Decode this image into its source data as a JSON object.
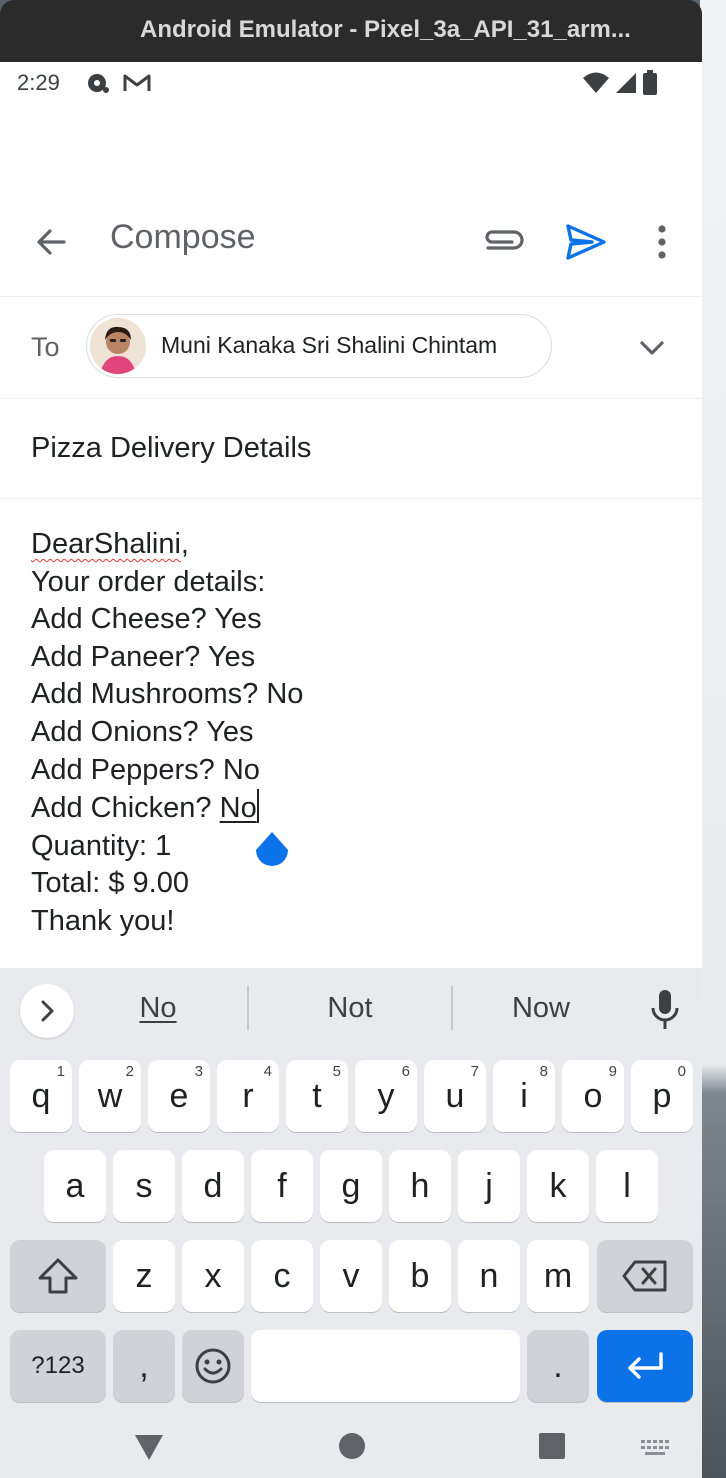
{
  "window": {
    "title": "Android Emulator - Pixel_3a_API_31_arm..."
  },
  "status_bar": {
    "time": "2:29"
  },
  "app_bar": {
    "title": "Compose"
  },
  "to": {
    "label": "To",
    "recipient": "Muni Kanaka Sri Shalini Chintam"
  },
  "subject": "Pizza Delivery Details",
  "body": {
    "greeting_name": "DearShalini",
    "greeting_punct": ",",
    "lines": [
      "Your order details:",
      "Add Cheese? Yes",
      "Add Paneer? Yes",
      "Add Mushrooms? No",
      "Add Onions? Yes",
      "Add Peppers? No"
    ],
    "chicken_prefix": "Add Chicken? ",
    "chicken_value": "No",
    "tail_lines": [
      "Quantity: 1",
      "Total: $ 9.00",
      "Thank you!"
    ]
  },
  "suggestions": [
    "No",
    "Not",
    "Now"
  ],
  "keyboard": {
    "row1": [
      {
        "k": "q",
        "n": "1"
      },
      {
        "k": "w",
        "n": "2"
      },
      {
        "k": "e",
        "n": "3"
      },
      {
        "k": "r",
        "n": "4"
      },
      {
        "k": "t",
        "n": "5"
      },
      {
        "k": "y",
        "n": "6"
      },
      {
        "k": "u",
        "n": "7"
      },
      {
        "k": "i",
        "n": "8"
      },
      {
        "k": "o",
        "n": "9"
      },
      {
        "k": "p",
        "n": "0"
      }
    ],
    "row2": [
      "a",
      "s",
      "d",
      "f",
      "g",
      "h",
      "j",
      "k",
      "l"
    ],
    "row3": [
      "z",
      "x",
      "c",
      "v",
      "b",
      "n",
      "m"
    ],
    "symbols_label": "?123",
    "comma": ",",
    "period": "."
  },
  "colors": {
    "accent": "#0b72e7",
    "text": "#202124",
    "muted": "#5f6368",
    "keyboard_bg": "#e8eaed"
  }
}
